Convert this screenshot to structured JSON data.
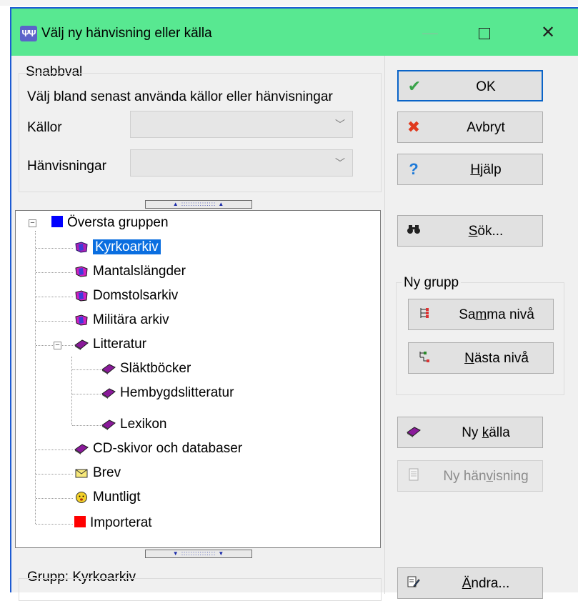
{
  "window": {
    "title": "Välj ny hänvisning eller källa",
    "icon": "app-icon-glyph"
  },
  "quick": {
    "group_label": "Snabbval",
    "description": "Välj bland senast använda källor eller hänvisningar",
    "sources_label": "Källor",
    "refs_label": "Hänvisningar"
  },
  "tree": {
    "root": "Översta gruppen",
    "items": [
      "Kyrkoarkiv",
      "Mantalslängder",
      "Domstolsarkiv",
      "Militära arkiv",
      "Litteratur",
      "Släktböcker",
      "Hembygdslitteratur",
      "Lexikon",
      "CD-skivor och databaser",
      "Brev",
      "Muntligt",
      "Importerat"
    ],
    "selected": "Kyrkoarkiv"
  },
  "footer": {
    "group_label": "Grupp: Kyrkoarkiv"
  },
  "buttons": {
    "ok": "OK",
    "cancel": "Avbryt",
    "help_pre": "",
    "help_u": "H",
    "help_post": "jälp",
    "search_pre": "",
    "search_u": "S",
    "search_post": "ök...",
    "new_group_label": "Ny grupp",
    "same_level_pre": "Sa",
    "same_level_u": "m",
    "same_level_post": "ma nivå",
    "next_level_pre": "",
    "next_level_u": "N",
    "next_level_post": "ästa nivå",
    "new_source_pre": "Ny ",
    "new_source_u": "k",
    "new_source_post": "älla",
    "new_ref_pre": "Ny hän",
    "new_ref_u": "v",
    "new_ref_post": "isning",
    "edit_pre": "",
    "edit_u": "Ä",
    "edit_post": "ndra..."
  },
  "colors": {
    "titlebar": "#58e891",
    "selection": "#0a6ee0",
    "border": "#1d5bd3"
  }
}
